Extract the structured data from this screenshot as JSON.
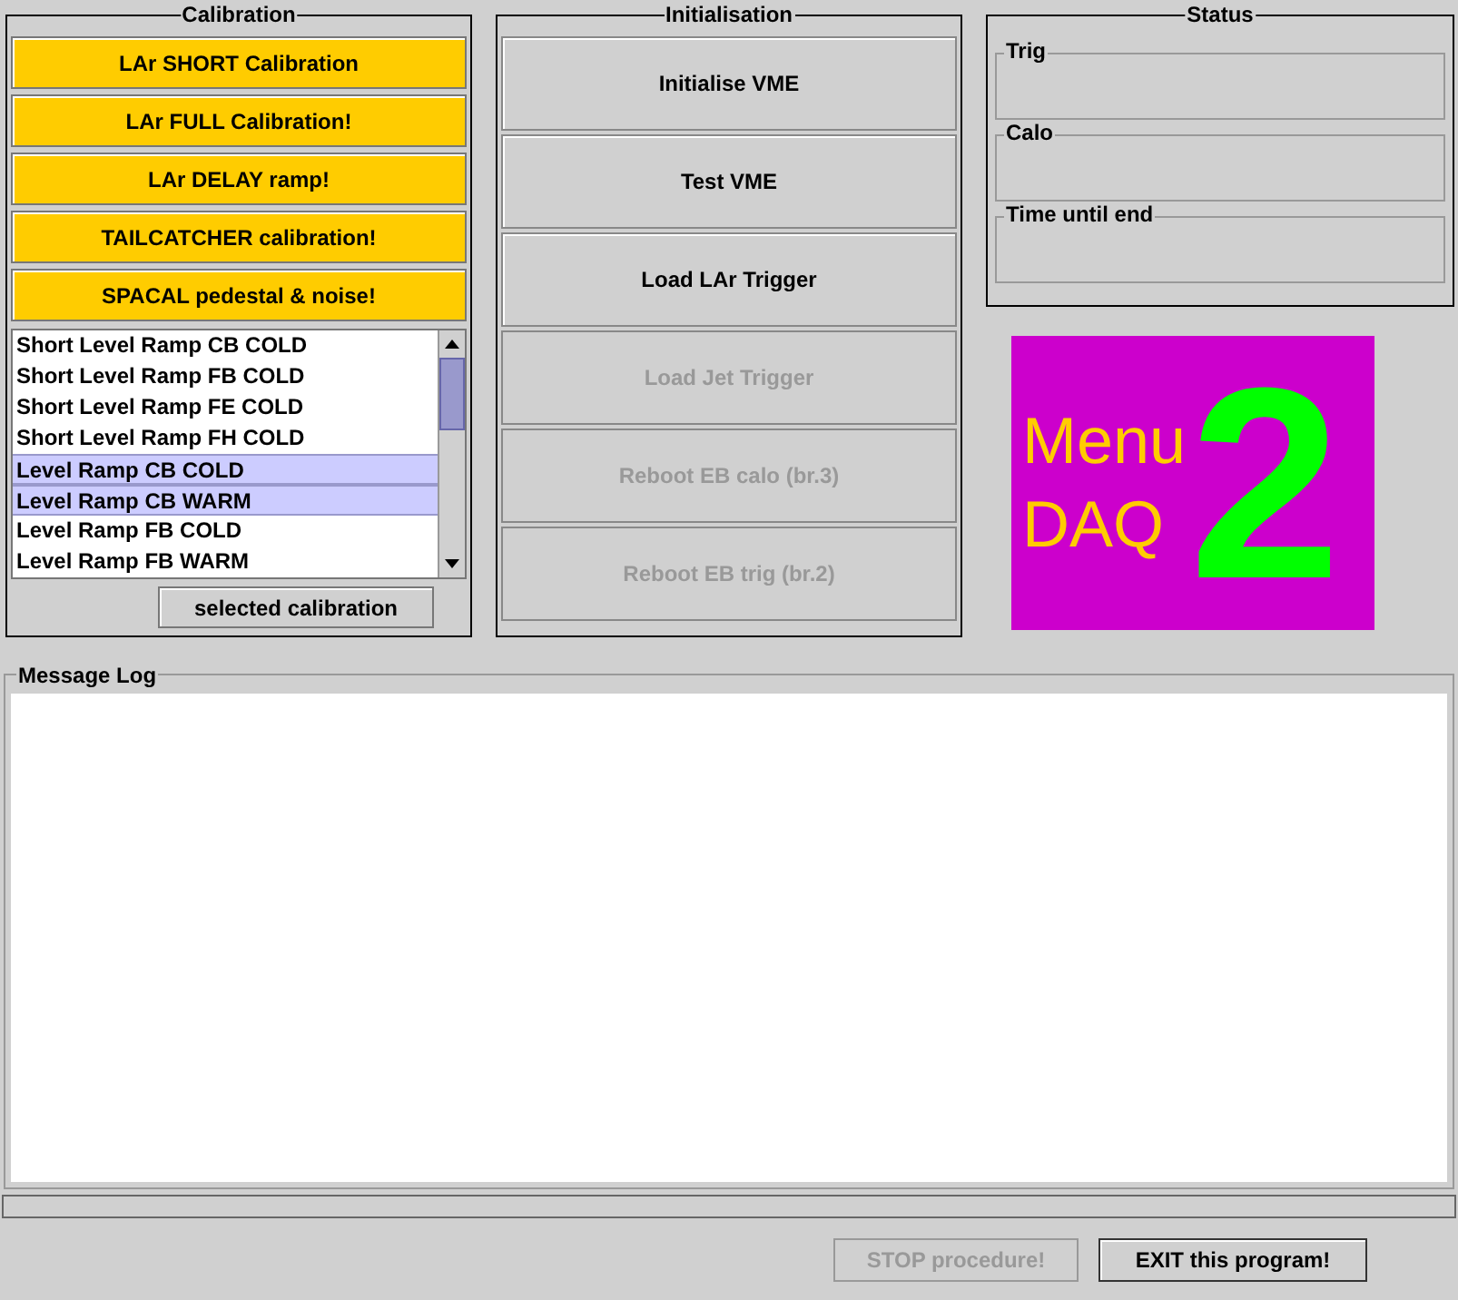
{
  "calibration": {
    "title": "Calibration",
    "buttons": [
      {
        "label": "LAr SHORT Calibration"
      },
      {
        "label": "LAr FULL Calibration!"
      },
      {
        "label": "LAr DELAY ramp!"
      },
      {
        "label": "TAILCATCHER calibration!"
      },
      {
        "label": "SPACAL pedestal & noise!"
      }
    ],
    "list": [
      {
        "label": "Short Level Ramp CB COLD",
        "selected": false
      },
      {
        "label": "Short Level Ramp FB COLD",
        "selected": false
      },
      {
        "label": "Short Level Ramp FE COLD",
        "selected": false
      },
      {
        "label": "Short Level Ramp FH COLD",
        "selected": false
      },
      {
        "label": "Level Ramp CB COLD",
        "selected": true
      },
      {
        "label": "Level Ramp CB WARM",
        "selected": true
      },
      {
        "label": "Level Ramp FB COLD",
        "selected": false
      },
      {
        "label": "Level Ramp FB WARM",
        "selected": false
      }
    ],
    "run_button": "selected calibration"
  },
  "initialisation": {
    "title": "Initialisation",
    "buttons": [
      {
        "label": "Initialise VME",
        "disabled": false
      },
      {
        "label": "Test VME",
        "disabled": false
      },
      {
        "label": "Load LAr Trigger",
        "disabled": false
      },
      {
        "label": "Load Jet Trigger",
        "disabled": true
      },
      {
        "label": "Reboot EB calo (br.3)",
        "disabled": true
      },
      {
        "label": "Reboot EB trig (br.2)",
        "disabled": true
      }
    ]
  },
  "status": {
    "title": "Status",
    "fields": [
      {
        "label": "Trig"
      },
      {
        "label": "Calo"
      },
      {
        "label": "Time until end"
      }
    ]
  },
  "logo": {
    "line_1": "Menu",
    "line_2": "DAQ",
    "number": "2"
  },
  "message_log": {
    "title": "Message Log"
  },
  "progress": {
    "level": 0
  },
  "buttons": [
    {
      "label": "STOP procedure!",
      "disabled": true
    },
    {
      "label": "EXIT this program!",
      "disabled": false
    }
  ]
}
